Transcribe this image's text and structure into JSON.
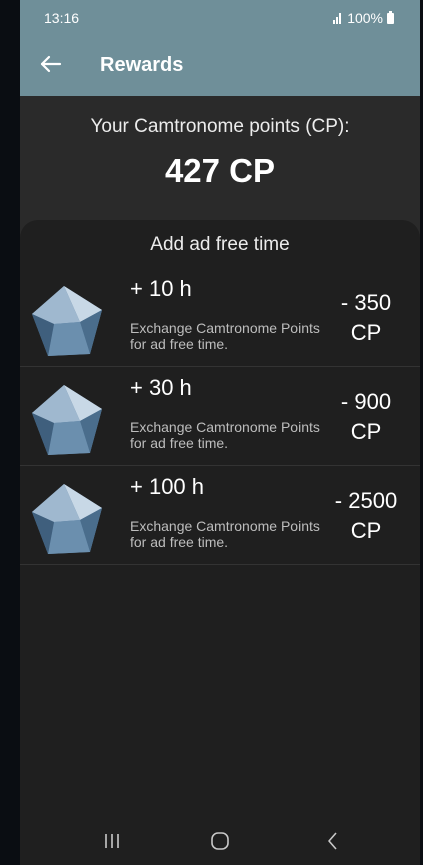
{
  "status_bar": {
    "time": "13:16",
    "battery_text": "100%"
  },
  "app_bar": {
    "title": "Rewards",
    "back_icon": "arrow-left-icon"
  },
  "points": {
    "label": "Your Camtronome points (CP):",
    "value": "427 CP"
  },
  "section": {
    "title": "Add ad free time"
  },
  "rewards": [
    {
      "amount": "+ 10 h",
      "description": "Exchange Camtronome Points for ad free time.",
      "cost_value": "- 350",
      "cost_unit": "CP",
      "icon": "gem-icon"
    },
    {
      "amount": "+ 30 h",
      "description": "Exchange Camtronome Points for ad free time.",
      "cost_value": "- 900",
      "cost_unit": "CP",
      "icon": "gem-icon"
    },
    {
      "amount": "+ 100 h",
      "description": "Exchange Camtronome Points for ad free time.",
      "cost_value": "- 2500",
      "cost_unit": "CP",
      "icon": "gem-icon"
    }
  ],
  "nav_bar": {
    "recent_icon": "recent-apps-icon",
    "home_icon": "home-icon",
    "back_icon": "back-chevron-icon"
  },
  "colors": {
    "header": "#6f8f99",
    "background": "#2a2a2a",
    "sheet": "#1f1f1f"
  }
}
